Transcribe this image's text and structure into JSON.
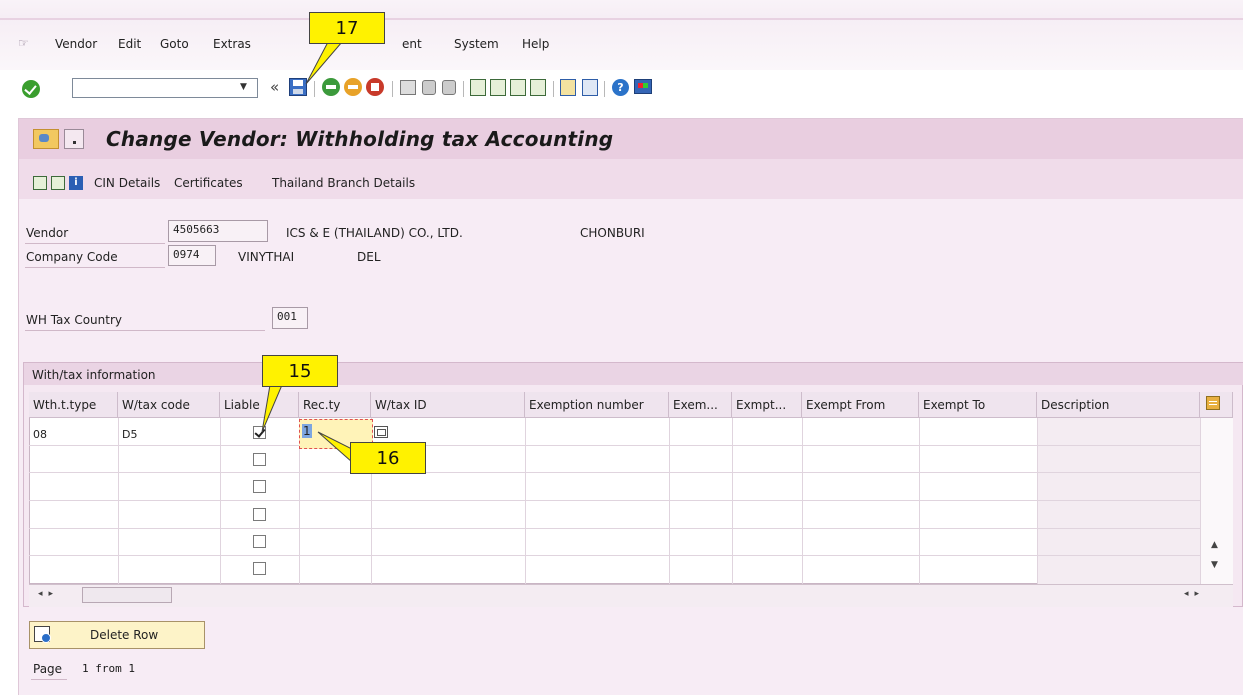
{
  "menu": {
    "items": [
      "Vendor",
      "Edit",
      "Goto",
      "Extras",
      "ent",
      "System",
      "Help"
    ]
  },
  "toolbar": {
    "command_value": "",
    "nav_back": "«"
  },
  "page": {
    "title": "Change Vendor: Withholding tax Accounting"
  },
  "app_toolbar": {
    "links": [
      "CIN Details",
      "Certificates",
      "Thailand Branch Details"
    ]
  },
  "header": {
    "vendor_label": "Vendor",
    "vendor_number": "4505663",
    "vendor_name": "ICS & E (THAILAND) CO., LTD.",
    "vendor_city": "CHONBURI",
    "company_code_label": "Company Code",
    "company_code": "0974",
    "company_name": "VINYTHAI",
    "company_extra": "DEL",
    "wh_tax_country_label": "WH Tax Country",
    "wh_tax_country": "001"
  },
  "withtax": {
    "group_title": "With/tax information",
    "columns": [
      "Wth.t.type",
      "W/tax code",
      "Liable",
      "Rec.ty",
      "W/tax ID",
      "Exemption number",
      "Exem...",
      "Exmpt...",
      "Exempt From",
      "Exempt To",
      "Description"
    ],
    "rows": [
      {
        "type": "08",
        "code": "D5",
        "liable": true,
        "recty": "1"
      },
      {
        "type": "",
        "code": "",
        "liable": false,
        "recty": ""
      },
      {
        "type": "",
        "code": "",
        "liable": false,
        "recty": ""
      },
      {
        "type": "",
        "code": "",
        "liable": false,
        "recty": ""
      },
      {
        "type": "",
        "code": "",
        "liable": false,
        "recty": ""
      },
      {
        "type": "",
        "code": "",
        "liable": false,
        "recty": ""
      }
    ]
  },
  "bottom": {
    "delete_row_label": "Delete Row",
    "page_label": "Page",
    "page_value": "1 from 1"
  },
  "callouts": {
    "c15": "15",
    "c16": "16",
    "c17": "17"
  },
  "colors": {
    "title_bg": "#e9cee0",
    "body_bg": "#f7ecf5",
    "callout": "#fff200",
    "ok_green": "#3a9e2e"
  }
}
